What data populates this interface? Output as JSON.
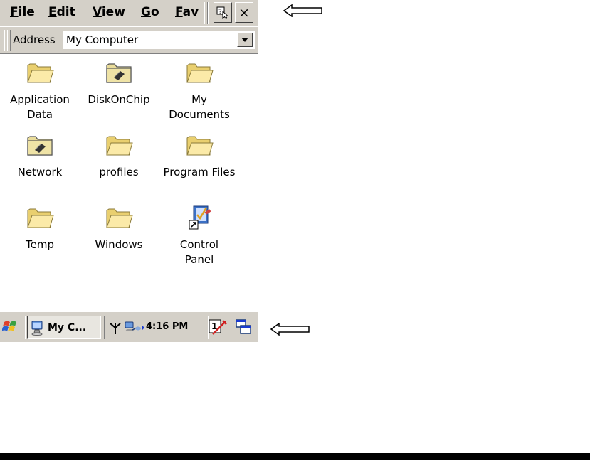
{
  "menubar": {
    "items": [
      {
        "label": "File",
        "accel": "F",
        "rest": "ile"
      },
      {
        "label": "Edit",
        "accel": "E",
        "rest": "dit"
      },
      {
        "label": "View",
        "accel": "V",
        "rest": "iew"
      },
      {
        "label": "Go",
        "accel": "G",
        "rest": "o"
      },
      {
        "label": "Fav",
        "accel": "F",
        "rest": "av"
      }
    ],
    "close_label": "×"
  },
  "address": {
    "label": "Address",
    "value": "My Computer"
  },
  "items": [
    {
      "label": "Application\nData",
      "icon": "folder-icon"
    },
    {
      "label": "DiskOnChip",
      "icon": "storage-folder-icon"
    },
    {
      "label": "My\nDocuments",
      "icon": "folder-icon"
    },
    {
      "label": "Network",
      "icon": "network-folder-icon"
    },
    {
      "label": "profiles",
      "icon": "folder-icon"
    },
    {
      "label": "Program Files",
      "icon": "folder-icon"
    },
    {
      "label": "Temp",
      "icon": "folder-icon"
    },
    {
      "label": "Windows",
      "icon": "folder-icon"
    },
    {
      "label": "Control\nPanel",
      "icon": "control-panel-shortcut-icon"
    }
  ],
  "taskbar": {
    "task_label": "My C...",
    "clock": "4:16 PM"
  },
  "colors": {
    "chrome": "#d4d0c8",
    "folder": "#f4e29a"
  }
}
